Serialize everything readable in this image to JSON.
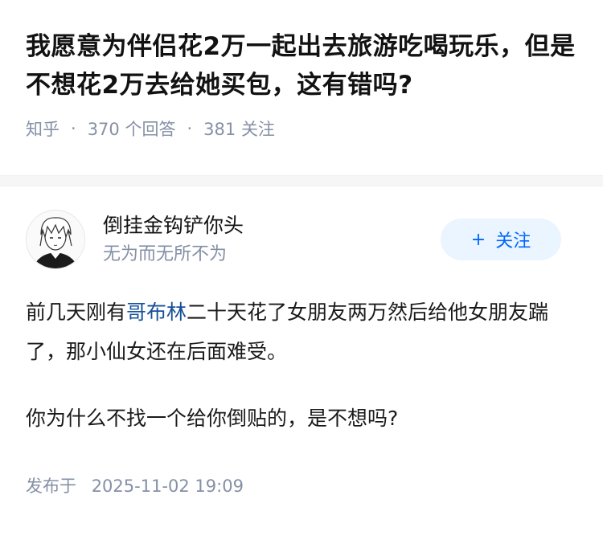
{
  "question": {
    "title": "我愿意为伴侣花2万一起出去旅游吃喝玩乐，但是不想花2万去给她买包，这有错吗?",
    "source": "知乎",
    "answers_count": "370",
    "answers_label": "个回答",
    "follow_count": "381",
    "follow_label": "关注",
    "separator": "·"
  },
  "author": {
    "name": "倒挂金钩铲你头",
    "bio": "无为而无所不为",
    "follow_icon": "+",
    "follow_label": "关注",
    "avatar_icon": "anime-avatar-icon"
  },
  "answer": {
    "para1_before": "前几天刚有",
    "para1_link": "哥布林",
    "para1_after": "二十天花了女朋友两万然后给他女朋友踹了，那小仙女还在后面难受。",
    "para2": "你为什么不找一个给你倒贴的，是不想吗?",
    "published_label": "发布于",
    "published_time": "2025-11-02 19:09"
  },
  "colors": {
    "meta": "#8590a6",
    "link": "#175199",
    "follow_bg": "#ebf5ff",
    "follow_text": "#0066ff"
  }
}
